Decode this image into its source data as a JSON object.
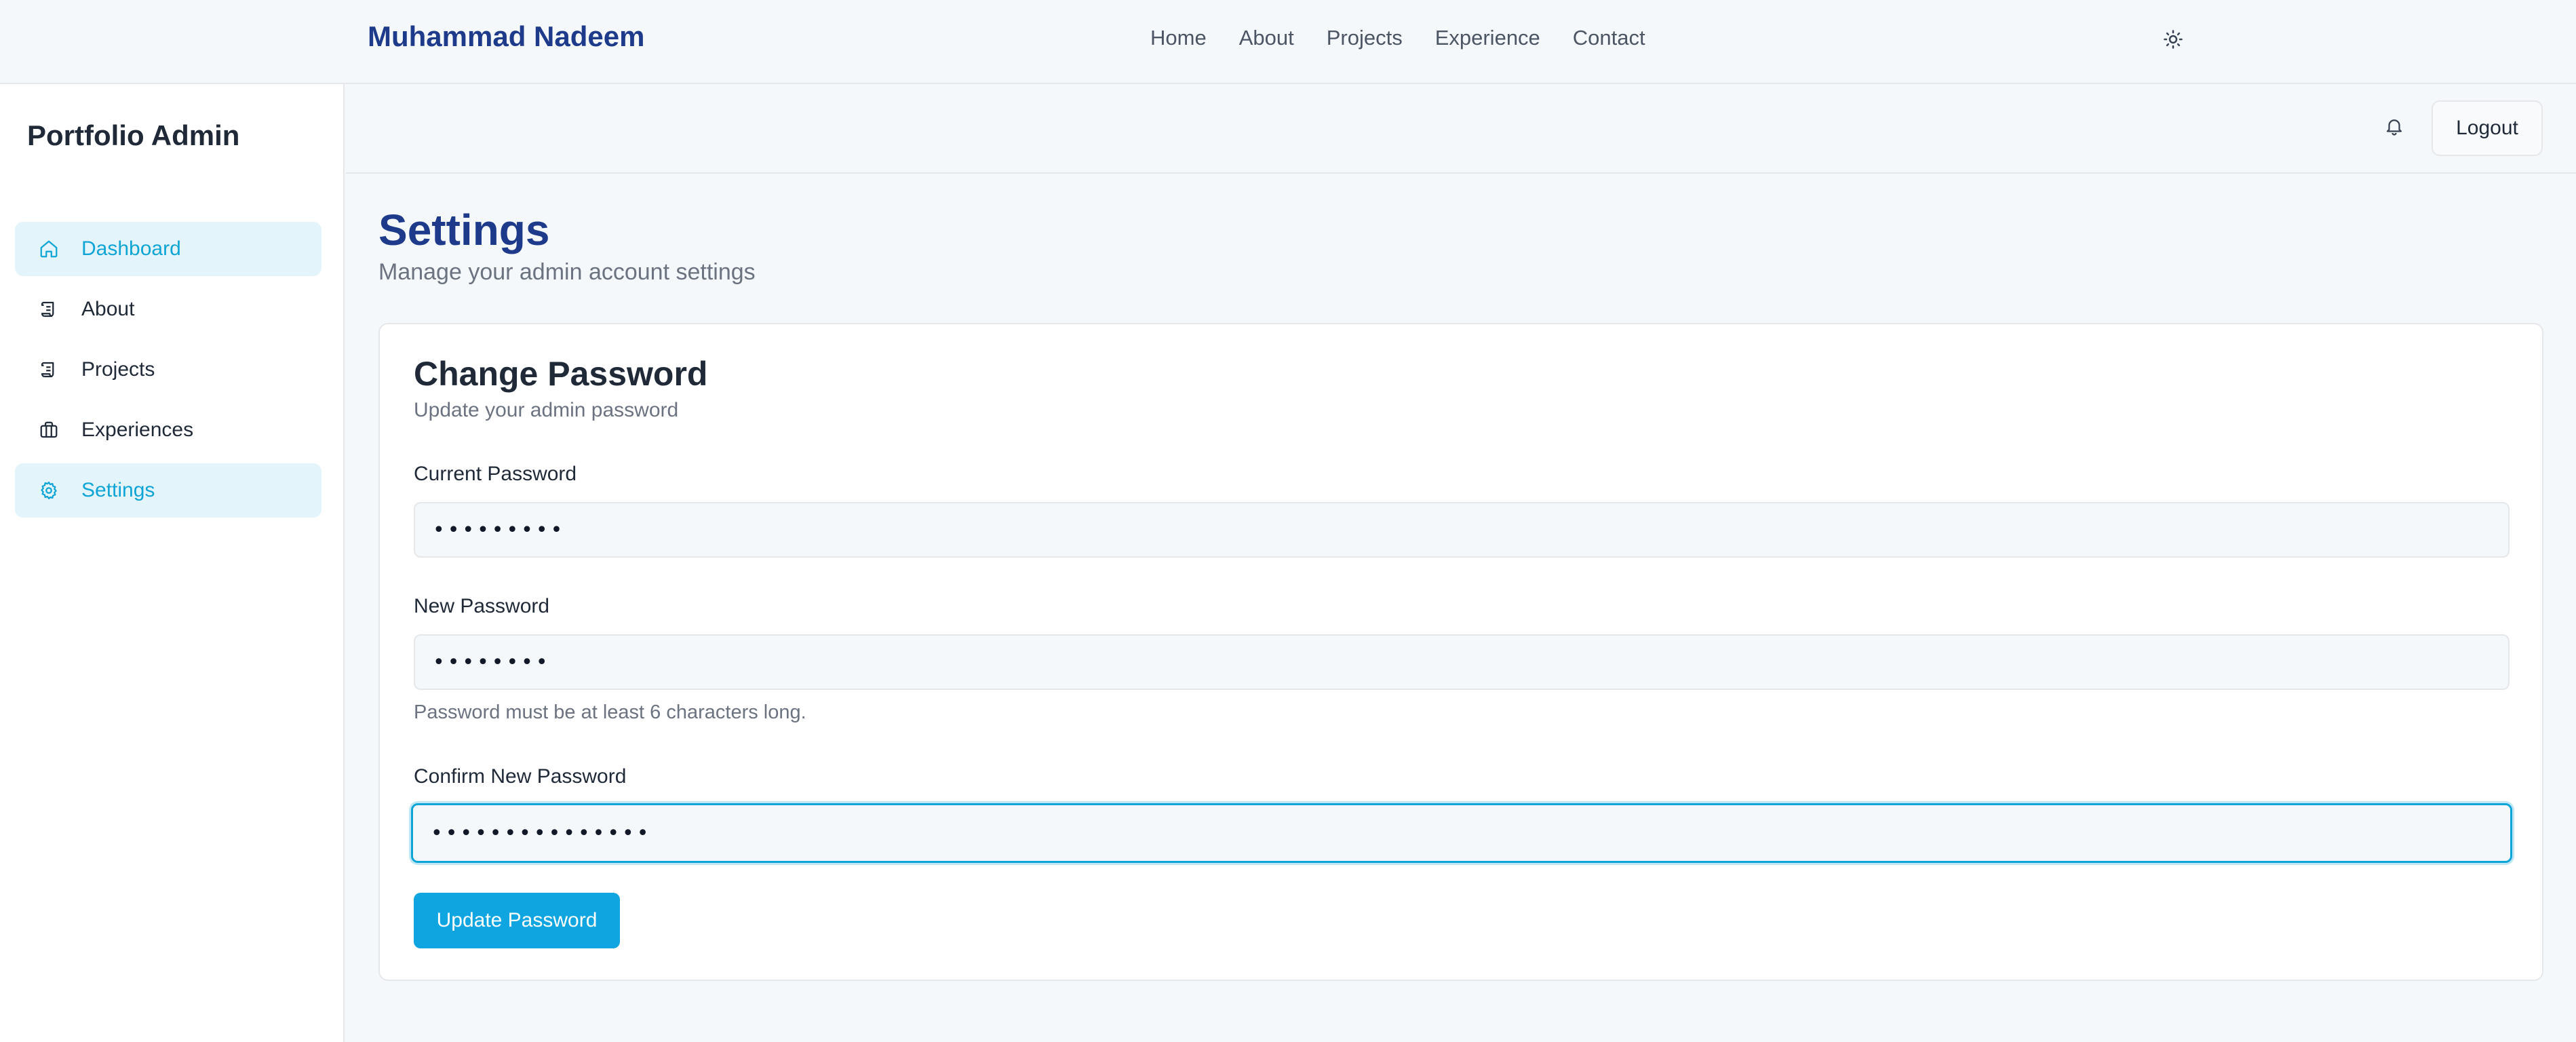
{
  "topbar": {
    "brand": "Muhammad Nadeem",
    "nav": [
      "Home",
      "About",
      "Projects",
      "Experience",
      "Contact"
    ],
    "theme_icon": "sun-icon"
  },
  "sidebar": {
    "title": "Portfolio Admin",
    "items": [
      {
        "label": "Dashboard",
        "icon": "home-icon",
        "active": true
      },
      {
        "label": "About",
        "icon": "scroll-icon",
        "active": false
      },
      {
        "label": "Projects",
        "icon": "scroll-icon",
        "active": false
      },
      {
        "label": "Experiences",
        "icon": "briefcase-icon",
        "active": false
      },
      {
        "label": "Settings",
        "icon": "gear-icon",
        "active": true
      }
    ]
  },
  "header": {
    "bell_icon": "bell-icon",
    "logout_label": "Logout"
  },
  "page": {
    "title": "Settings",
    "subtitle": "Manage your admin account settings"
  },
  "card": {
    "title": "Change Password",
    "subtitle": "Update your admin password",
    "current_label": "Current Password",
    "current_value": "•••••••••",
    "new_label": "New Password",
    "new_value": "••••••••",
    "new_hint": "Password must be at least 6 characters long.",
    "confirm_label": "Confirm New Password",
    "confirm_value": "•••••••••••••••",
    "submit_label": "Update Password"
  },
  "colors": {
    "brand": "#1e3a8a",
    "accent": "#0ea5e0",
    "active_bg": "#e3f4fb"
  }
}
